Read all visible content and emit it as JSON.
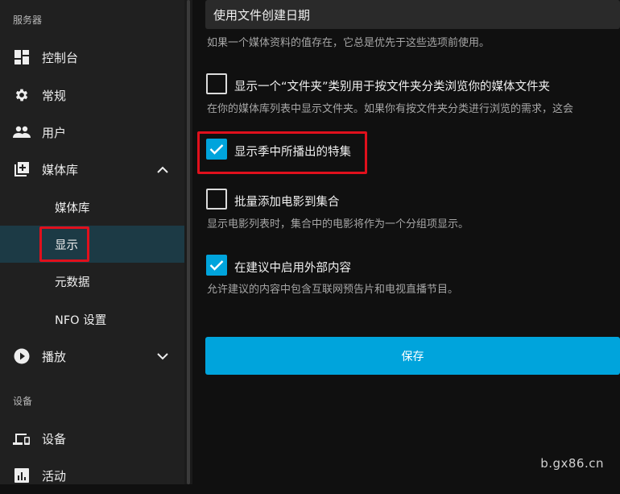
{
  "sidebar": {
    "server_section": "服务器",
    "devices_section": "设备",
    "items": [
      {
        "label": "控制台",
        "icon": "dashboard-icon"
      },
      {
        "label": "常规",
        "icon": "gear-icon"
      },
      {
        "label": "用户",
        "icon": "users-icon"
      },
      {
        "label": "媒体库",
        "icon": "library-add-icon"
      },
      {
        "label": "播放",
        "icon": "play-circle-icon"
      }
    ],
    "library_sub": [
      {
        "label": "媒体库"
      },
      {
        "label": "显示",
        "active": true
      },
      {
        "label": "元数据"
      },
      {
        "label": "NFO 设置"
      }
    ],
    "device_items": [
      {
        "label": "设备",
        "icon": "devices-icon"
      },
      {
        "label": "活动",
        "icon": "activity-icon"
      }
    ]
  },
  "main": {
    "date_select_value": "使用文件创建日期",
    "date_help": "如果一个媒体资料的值存在，它总是优先于这些选项前使用。",
    "options": [
      {
        "label": "显示一个“文件夹”类别用于按文件夹分类浏览你的媒体文件夹",
        "checked": false,
        "help": "在你的媒体库列表中显示文件夹。如果你有按文件夹分类进行浏览的需求，这会"
      },
      {
        "label": "显示季中所播出的特集",
        "checked": true,
        "help": ""
      },
      {
        "label": "批量添加电影到集合",
        "checked": false,
        "help": "显示电影列表时，集合中的电影将作为一个分组项显示。"
      },
      {
        "label": "在建议中启用外部内容",
        "checked": true,
        "help": "允许建议的内容中包含互联网预告片和电视直播节目。"
      }
    ],
    "save_label": "保存"
  },
  "watermark": "b.gx86.cn",
  "colors": {
    "accent": "#00a4dc",
    "highlight": "#e0101c",
    "sidebar_active": "#1c3a45"
  }
}
